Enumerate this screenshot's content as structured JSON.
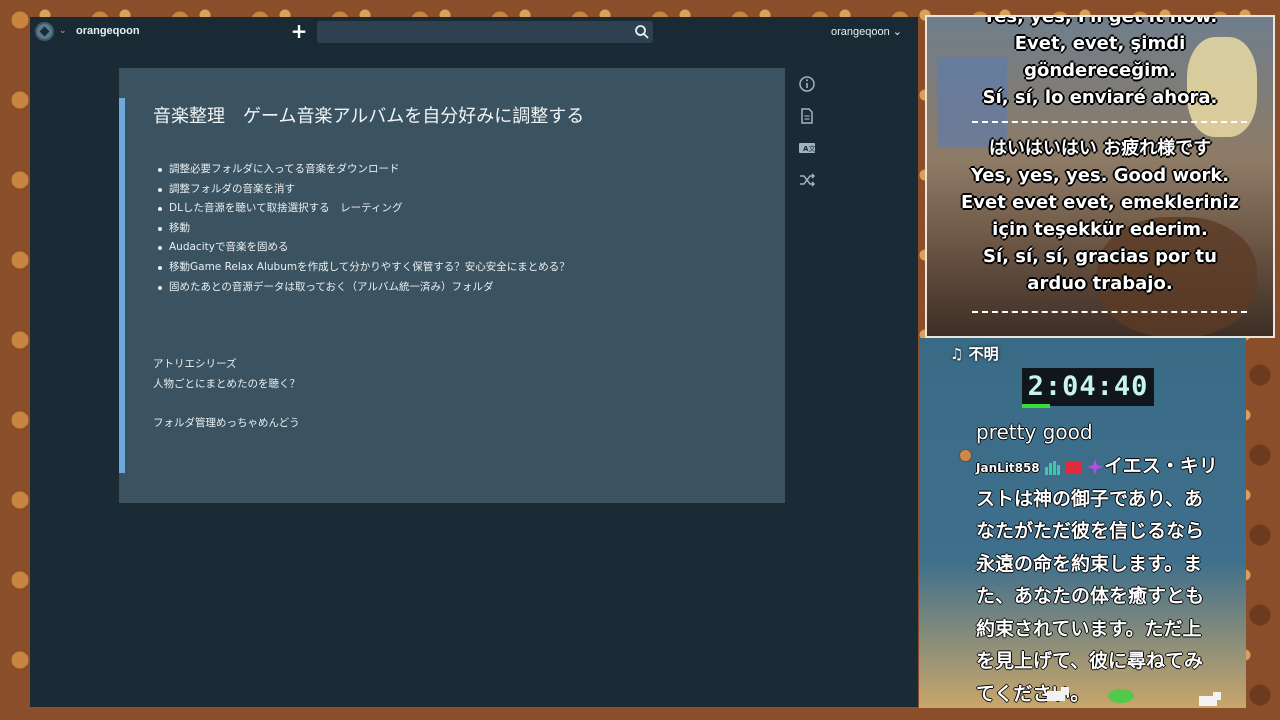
{
  "app": {
    "username": "orangeqoon",
    "search_placeholder": ""
  },
  "note": {
    "title": "音楽整理　ゲーム音楽アルバムを自分好みに調整する",
    "items": [
      "調整必要フォルダに入ってる音楽をダウンロード",
      "調整フォルダの音楽を消す",
      "DLした音源を聴いて取捨選択する　レーティング",
      "移動",
      "Audacityで音楽を固める",
      "移動Game Relax Alubumを作成して分かりやすく保管する？安心安全にまとめる？",
      "固めたあとの音源データは取っておく（アルバム統一済み）フォルダ"
    ],
    "para1_line1": "アトリエシリーズ",
    "para1_line2": "人物ごとにまとめたのを聴く？",
    "para2": "フォルダ管理めっちゃめんどう"
  },
  "side_icons": [
    "info-icon",
    "document-icon",
    "translate-icon",
    "shuffle-icon"
  ],
  "subtitles": {
    "block1": [
      "Yes, yes, I'll get it now.",
      "Evet, evet, şimdi",
      "göndereceğim.",
      "Sí, sí, lo enviaré ahora."
    ],
    "block2": [
      "はいはいはい お疲れ様です",
      "Yes, yes, yes. Good work.",
      "Evet evet evet, emekleriniz",
      "için teşekkür ederim.",
      "Sí, sí, sí, gracias por tu",
      "arduo trabajo."
    ]
  },
  "overlay": {
    "now_playing": "♫ 不明",
    "timer": "2:04:40",
    "chat_message_1": "pretty good",
    "chat_user": "JanLit858",
    "chat_text_first": "イエス・キリ",
    "chat_text_lines": [
      "ストは神の御子であり、あ",
      "なたがただ彼を信じるなら",
      "永遠の命を約束します。ま",
      "た、あなたの体を癒すとも",
      "約束されています。ただ上",
      "を見上げて、彼に尋ねてみ",
      "てください。"
    ]
  },
  "colors": {
    "app_bg": "#1b2b36",
    "note_bg": "#3b5360",
    "accent": "#6fa8dc",
    "timer_text": "#c6f5ea"
  }
}
